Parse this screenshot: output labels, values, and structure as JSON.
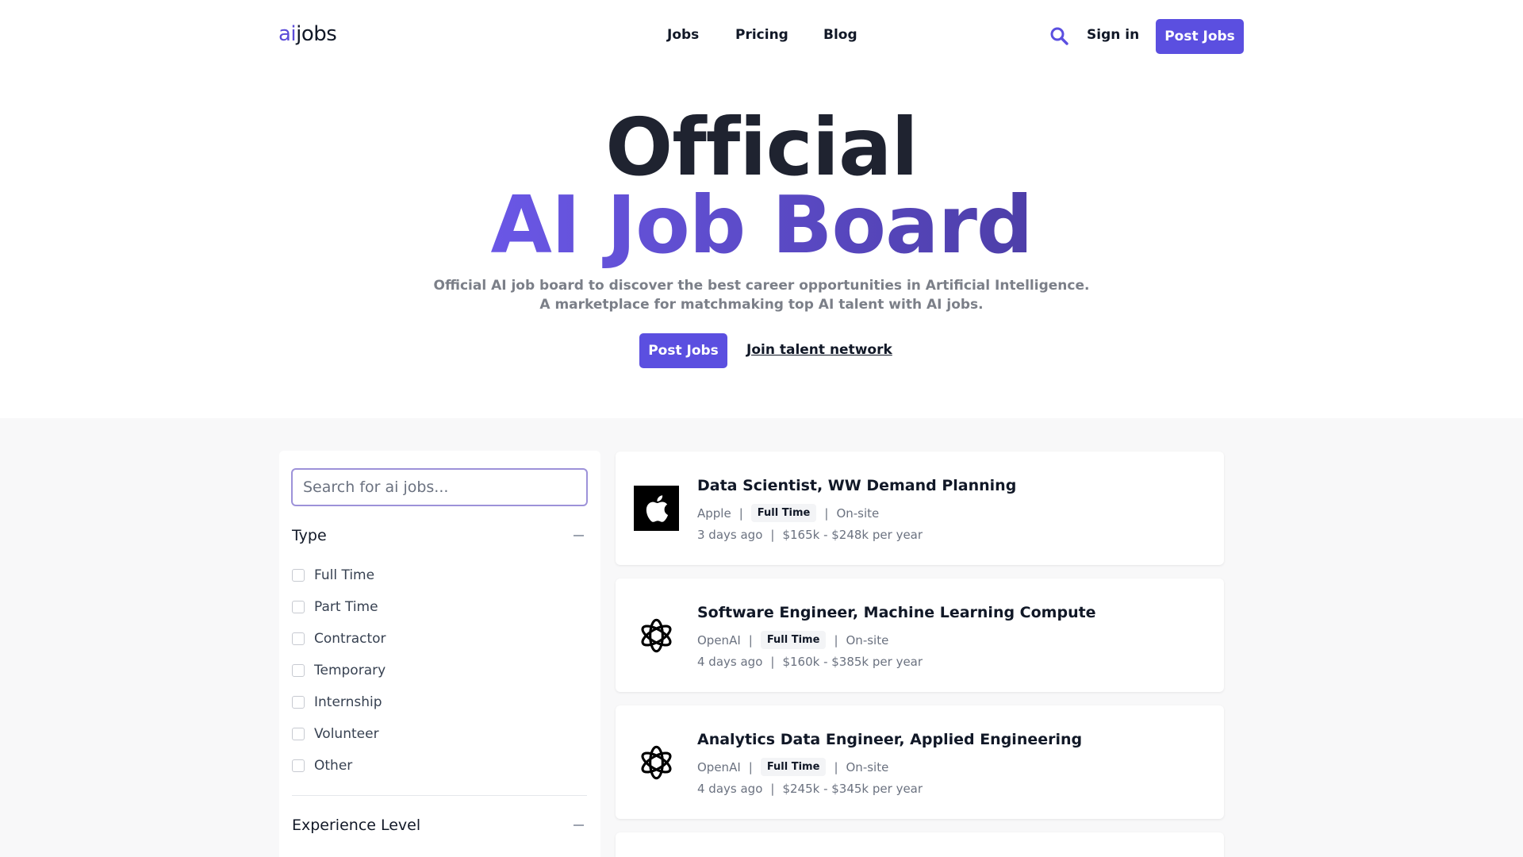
{
  "nav": {
    "logo_ai": "ai",
    "logo_jobs": "jobs",
    "links": [
      "Jobs",
      "Pricing",
      "Blog"
    ],
    "sign_in": "Sign in",
    "post_jobs": "Post Jobs"
  },
  "hero": {
    "title_line1": "Official",
    "title_line2": "AI Job Board",
    "subtitle": "Official AI job board to discover the best career opportunities in Artificial Intelligence. A marketplace for matchmaking top AI talent with AI jobs.",
    "post_jobs": "Post Jobs",
    "join": "Join talent network"
  },
  "filters": {
    "search_placeholder": "Search for ai jobs...",
    "type_title": "Type",
    "type_options": [
      "Full Time",
      "Part Time",
      "Contractor",
      "Temporary",
      "Internship",
      "Volunteer",
      "Other"
    ],
    "experience_title": "Experience Level"
  },
  "jobs": [
    {
      "title": "Data Scientist, WW Demand Planning",
      "company": "Apple",
      "type": "Full Time",
      "location": "On-site",
      "posted": "3 days ago",
      "salary": "$165k - $248k per year",
      "logo_icon": "apple-logo-icon"
    },
    {
      "title": "Software Engineer, Machine Learning Compute",
      "company": "OpenAI",
      "type": "Full Time",
      "location": "On-site",
      "posted": "4 days ago",
      "salary": "$160k - $385k per year",
      "logo_icon": "openai-logo-icon"
    },
    {
      "title": "Analytics Data Engineer, Applied Engineering",
      "company": "OpenAI",
      "type": "Full Time",
      "location": "On-site",
      "posted": "4 days ago",
      "salary": "$245k - $345k per year",
      "logo_icon": "openai-logo-icon"
    }
  ],
  "colors": {
    "accent": "#5b4fe0",
    "gradient_start": "#6a57e6",
    "gradient_end": "#4d3ea8"
  }
}
